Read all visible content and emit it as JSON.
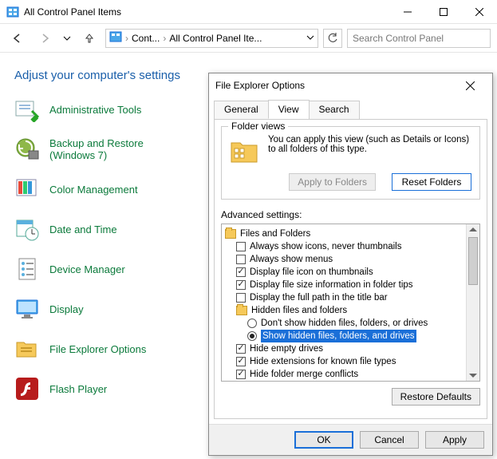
{
  "window": {
    "title": "All Control Panel Items"
  },
  "nav": {
    "crumb1": "Cont...",
    "crumb2": "All Control Panel Ite...",
    "search_placeholder": "Search Control Panel"
  },
  "content": {
    "heading": "Adjust your computer's settings",
    "items": [
      "Administrative Tools",
      "Backup and Restore (Windows 7)",
      "Color Management",
      "Date and Time",
      "Device Manager",
      "Display",
      "File Explorer Options",
      "Flash Player"
    ]
  },
  "dialog": {
    "title": "File Explorer Options",
    "tabs": {
      "general": "General",
      "view": "View",
      "search": "Search"
    },
    "folder_views": {
      "legend": "Folder views",
      "desc": "You can apply this view (such as Details or Icons) to all folders of this type.",
      "apply_btn": "Apply to Folders",
      "reset_btn": "Reset Folders"
    },
    "adv_label": "Advanced settings:",
    "restore_btn": "Restore Defaults",
    "footer": {
      "ok": "OK",
      "cancel": "Cancel",
      "apply": "Apply"
    },
    "tree": {
      "root": "Files and Folders",
      "n1": "Always show icons, never thumbnails",
      "n2": "Always show menus",
      "n3": "Display file icon on thumbnails",
      "n4": "Display file size information in folder tips",
      "n5": "Display the full path in the title bar",
      "hidden_folder": "Hidden files and folders",
      "r1": "Don't show hidden files, folders, or drives",
      "r2": "Show hidden files, folders, and drives",
      "n6": "Hide empty drives",
      "n7": "Hide extensions for known file types",
      "n8": "Hide folder merge conflicts"
    }
  },
  "icons": {
    "cp_small": "control-panel-icon"
  }
}
